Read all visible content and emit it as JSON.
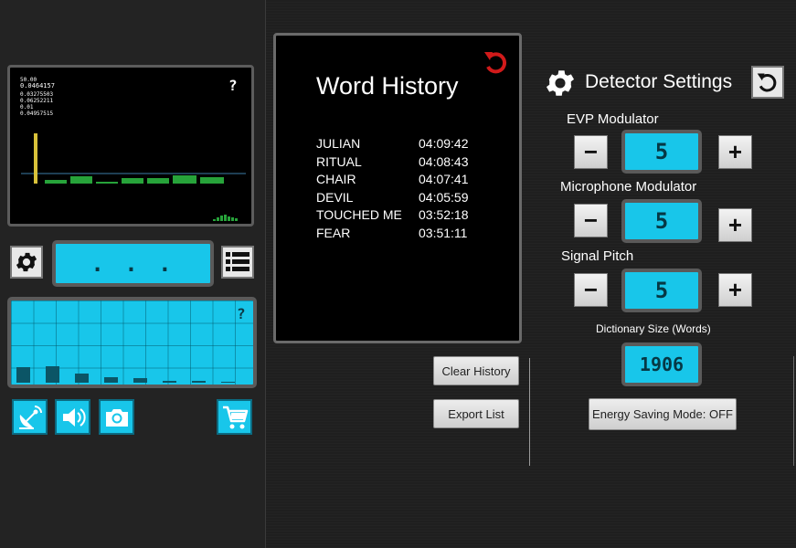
{
  "scope": {
    "readouts": [
      "50.00",
      "0.0464157",
      "0.03275503",
      "0.06252211",
      "0.01",
      "0.04957515"
    ],
    "help_label": "?"
  },
  "word_display": {
    "text": ". . ."
  },
  "equalizer": {
    "help_label": "?",
    "levels": [
      0.19,
      0.2,
      0.11,
      0.06,
      0.05,
      0.02,
      0.02,
      0.01
    ]
  },
  "history": {
    "title": "Word History",
    "entries": [
      {
        "word": "JULIAN",
        "time": "04:09:42"
      },
      {
        "word": "RITUAL",
        "time": "04:08:43"
      },
      {
        "word": "CHAIR",
        "time": "04:07:41"
      },
      {
        "word": "DEVIL",
        "time": "04:05:59"
      },
      {
        "word": "TOUCHED ME",
        "time": "03:52:18"
      },
      {
        "word": "FEAR",
        "time": "03:51:11"
      }
    ],
    "clear_label": "Clear History",
    "export_label": "Export List"
  },
  "settings": {
    "title": "Detector Settings",
    "evp": {
      "label": "EVP Modulator",
      "value": "5"
    },
    "mic": {
      "label": "Microphone Modulator",
      "value": "5"
    },
    "pitch": {
      "label": "Signal Pitch",
      "value": "5"
    },
    "minus_label": "−",
    "plus_label": "+",
    "dictionary_label": "Dictionary Size (Words)",
    "dictionary_value": "1906",
    "energy_label": "Energy Saving Mode: OFF"
  },
  "colors": {
    "lcd": "#18c6ea",
    "accent_red": "#d11a1a",
    "scope_line": "#3b7ea8",
    "scope_bar": "#27a33a"
  },
  "icons": [
    "gear-icon",
    "list-icon",
    "satellite-dish-icon",
    "speaker-icon",
    "camera-icon",
    "cart-icon",
    "red-undo-icon",
    "reset-icon"
  ]
}
